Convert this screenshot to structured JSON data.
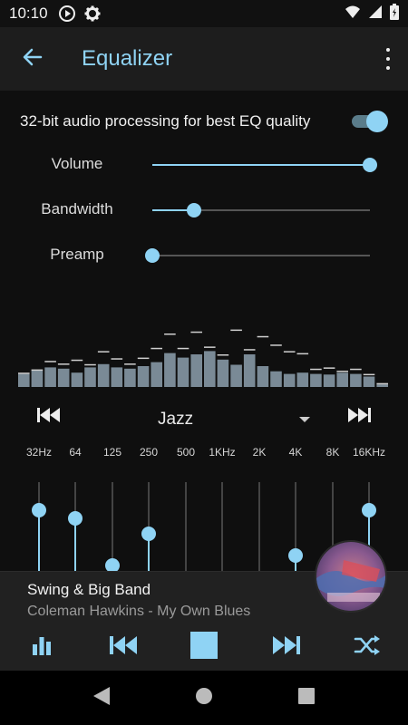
{
  "status_bar": {
    "time": "10:10"
  },
  "toolbar": {
    "title": "Equalizer"
  },
  "settings": {
    "hq_label": "32-bit audio processing for best EQ quality",
    "hq_enabled": true,
    "sliders": [
      {
        "label": "Volume",
        "value": 1.0
      },
      {
        "label": "Bandwidth",
        "value": 0.19
      },
      {
        "label": "Preamp",
        "value": 0.0
      }
    ]
  },
  "spectrum": {
    "bars": [
      0.2,
      0.25,
      0.3,
      0.28,
      0.22,
      0.3,
      0.35,
      0.3,
      0.28,
      0.32,
      0.38,
      0.52,
      0.45,
      0.5,
      0.55,
      0.42,
      0.34,
      0.5,
      0.32,
      0.24,
      0.2,
      0.22,
      0.2,
      0.19,
      0.22,
      0.2,
      0.16,
      0.04
    ],
    "peaks": [
      0.22,
      0.27,
      0.4,
      0.36,
      0.42,
      0.35,
      0.55,
      0.44,
      0.36,
      0.45,
      0.6,
      0.82,
      0.6,
      0.85,
      0.62,
      0.5,
      0.88,
      0.58,
      0.78,
      0.65,
      0.55,
      0.52,
      0.28,
      0.3,
      0.25,
      0.28,
      0.2,
      0.06
    ]
  },
  "preset": {
    "name": "Jazz"
  },
  "eq": {
    "colors": {
      "accent": "#8fd3f4",
      "track": "#444444"
    },
    "bands": [
      {
        "label": "32Hz",
        "level": 0.72
      },
      {
        "label": "64",
        "level": 0.62
      },
      {
        "label": "125",
        "level": 0.08
      },
      {
        "label": "250",
        "level": 0.45
      },
      {
        "label": "500",
        "level": 0.0
      },
      {
        "label": "1KHz",
        "level": 0.0
      },
      {
        "label": "2K",
        "level": 0.0
      },
      {
        "label": "4K",
        "level": 0.2
      },
      {
        "label": "8K",
        "level": 0.0
      },
      {
        "label": "16KHz",
        "level": 0.72
      }
    ]
  },
  "now_playing": {
    "title": "Swing & Big Band",
    "subtitle": "Coleman Hawkins - My Own Blues"
  },
  "icons": {
    "status": [
      "play-circle-icon",
      "gear-icon",
      "wifi-icon",
      "cell-signal-icon",
      "battery-icon"
    ],
    "toolbar": [
      "back-arrow-icon",
      "more-vert-icon"
    ],
    "player": [
      "bars-icon",
      "skip-previous-icon",
      "stop-icon",
      "skip-next-icon",
      "shuffle-icon"
    ],
    "nav": [
      "nav-back-icon",
      "nav-home-icon",
      "nav-recents-icon"
    ]
  }
}
